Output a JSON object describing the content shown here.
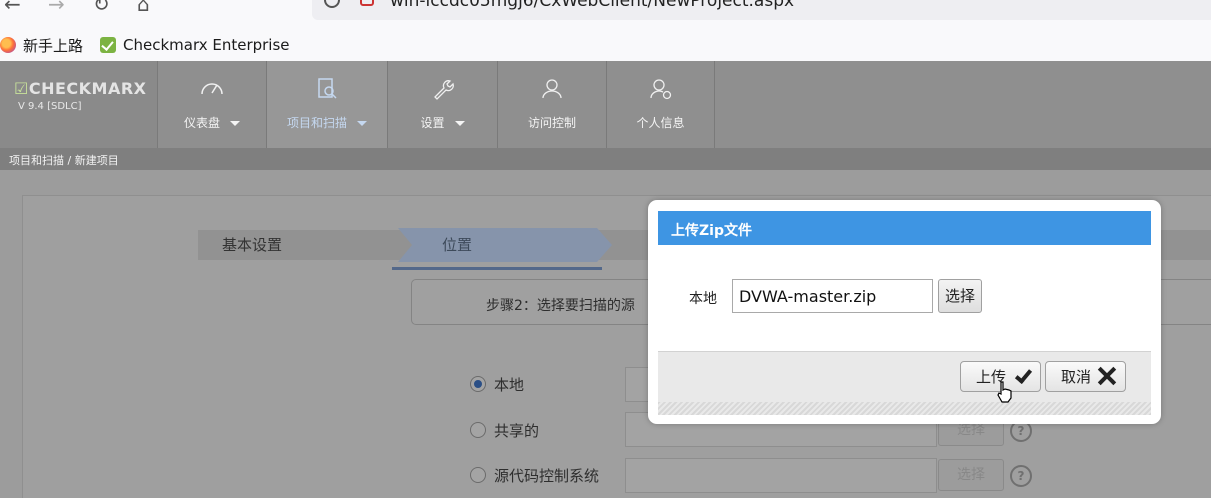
{
  "browser": {
    "url": "win-lccdc05mgj6/CxWebClient/NewProject.aspx",
    "bookmarks": [
      {
        "label": "新手上路",
        "icon": "firefox-icon"
      },
      {
        "label": "Checkmarx Enterprise",
        "icon": "checkmarx-icon"
      }
    ]
  },
  "header": {
    "logo": "CHECKMARX",
    "version": "V 9.4  [SDLC]",
    "menu": [
      {
        "label": "仪表盘",
        "icon": "gauge-icon",
        "dropdown": true
      },
      {
        "label": "项目和扫描",
        "icon": "project-scan-icon",
        "dropdown": true,
        "active": true
      },
      {
        "label": "设置",
        "icon": "wrench-icon",
        "dropdown": true
      },
      {
        "label": "访问控制",
        "icon": "users-icon",
        "dropdown": false
      },
      {
        "label": "个人信息",
        "icon": "user-settings-icon",
        "dropdown": false
      }
    ]
  },
  "breadcrumb": "项目和扫描 / 新建项目",
  "wizard": {
    "step1": "基本设置",
    "step2": "位置",
    "instruction": "步骤2：选择要扫描的源",
    "options": [
      {
        "label": "本地",
        "selected": true
      },
      {
        "label": "共享的",
        "selected": false,
        "button": "选择"
      },
      {
        "label": "源代码控制系统",
        "selected": false,
        "button": "选择"
      }
    ],
    "help": "?"
  },
  "modal": {
    "title": "上传Zip文件",
    "local_label": "本地",
    "file_value": "DVWA-master.zip",
    "choose_label": "选择",
    "upload_label": "上传",
    "cancel_label": "取消"
  },
  "colors": {
    "modal_header": "#3e95e3",
    "nav_bg": "#8f8f8f",
    "active_menu_text": "#c5d8f0"
  }
}
